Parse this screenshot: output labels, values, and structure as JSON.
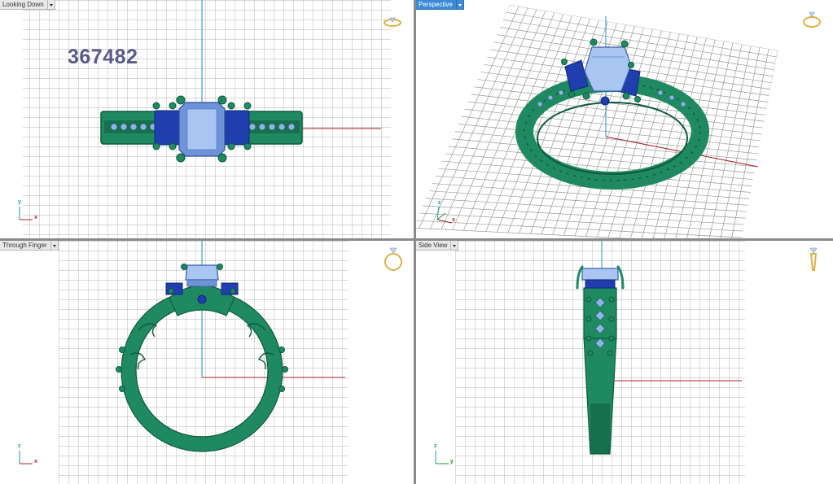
{
  "viewports": {
    "top_left": {
      "title": "Looking Down",
      "stamp": "367482"
    },
    "top_right": {
      "title": "Perspective"
    },
    "bottom_left": {
      "title": "Through Finger"
    },
    "bottom_right": {
      "title": "Side View"
    }
  },
  "axis_labels": {
    "looking_down": {
      "vertical": "y",
      "horizontal": "x"
    },
    "perspective": {
      "vertical": "z",
      "horizontal": "x"
    },
    "through_finger": {
      "vertical": "z",
      "horizontal": "x"
    },
    "side_view": {
      "vertical": "z",
      "horizontal": "y"
    }
  },
  "colors": {
    "metal": "#1f8a62",
    "metal_dark": "#0e5a3c",
    "center_stone": "#a9c6f2",
    "side_stone": "#1f3fae",
    "accent_stone": "#8fb1ea",
    "grid": "#9a9a9a",
    "axis_red": "#a62020",
    "axis_cyan": "#1a9aa6",
    "active_title": "#3d8ad6"
  },
  "icons": [
    "view-cube-icon",
    "ring-icon",
    "axis-widget-icon",
    "viewport-menu-icon"
  ]
}
